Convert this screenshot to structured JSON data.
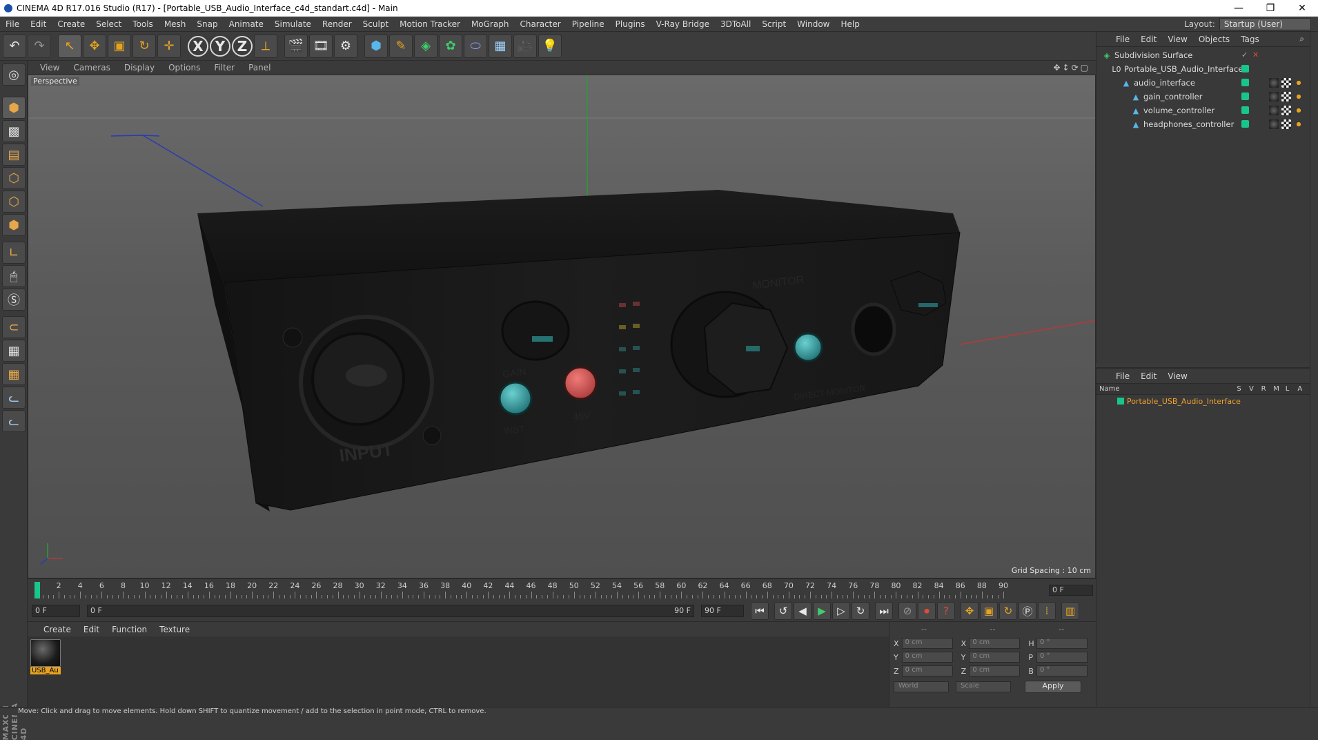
{
  "window": {
    "title": "CINEMA 4D R17.016 Studio (R17) - [Portable_USB_Audio_Interface_c4d_standart.c4d] - Main",
    "controls": [
      "—",
      "❐",
      "✕"
    ]
  },
  "menubar": {
    "items": [
      "File",
      "Edit",
      "Create",
      "Select",
      "Tools",
      "Mesh",
      "Snap",
      "Animate",
      "Simulate",
      "Render",
      "Sculpt",
      "Motion Tracker",
      "MoGraph",
      "Character",
      "Pipeline",
      "Plugins",
      "V-Ray Bridge",
      "3DToAll",
      "Script",
      "Window",
      "Help"
    ],
    "layout_label": "Layout:",
    "layout_value": "Startup (User)"
  },
  "toolbar": {
    "undo": "↶",
    "redo": "↷",
    "select": "↖",
    "move": "✥",
    "scale": "▣",
    "rotate": "↻",
    "transform": "✛",
    "x_axis": "X",
    "y_axis": "Y",
    "z_axis": "Z",
    "coord": "⟂"
  },
  "viewport": {
    "menu": [
      "View",
      "Cameras",
      "Display",
      "Options",
      "Filter",
      "Panel"
    ],
    "nav_icons": "✥↕⟳▢",
    "label": "Perspective",
    "grid_spacing": "Grid Spacing : 10 cm",
    "model_labels": {
      "input": "INPUT",
      "gain": "GAIN",
      "monitor": "MONITOR",
      "direct_monitor": "DIRECT MONITOR",
      "instrument": "INST",
      "phantom": "48V"
    }
  },
  "timeline": {
    "ticks": [
      "0",
      "2",
      "4",
      "6",
      "8",
      "10",
      "12",
      "14",
      "16",
      "18",
      "20",
      "22",
      "24",
      "26",
      "28",
      "30",
      "32",
      "34",
      "36",
      "38",
      "40",
      "42",
      "44",
      "46",
      "48",
      "50",
      "52",
      "54",
      "56",
      "58",
      "60",
      "62",
      "64",
      "66",
      "68",
      "70",
      "72",
      "74",
      "76",
      "78",
      "80",
      "82",
      "84",
      "86",
      "88",
      "90"
    ],
    "current_frame": "0 F"
  },
  "transport": {
    "start_field": "0 F",
    "range_start": "0 F",
    "range_end": "90 F",
    "end_field": "90 F"
  },
  "material_manager": {
    "menu": [
      "Create",
      "Edit",
      "Function",
      "Texture"
    ],
    "materials": [
      {
        "name": "USB_Au"
      }
    ]
  },
  "coordinates": {
    "headers": [
      "--",
      "--",
      "--"
    ],
    "rows": [
      {
        "a1": "X",
        "v1": "0 cm",
        "a2": "X",
        "v2": "0 cm",
        "a3": "H",
        "v3": "0 °"
      },
      {
        "a1": "Y",
        "v1": "0 cm",
        "a2": "Y",
        "v2": "0 cm",
        "a3": "P",
        "v3": "0 °"
      },
      {
        "a1": "Z",
        "v1": "0 cm",
        "a2": "Z",
        "v2": "0 cm",
        "a3": "B",
        "v3": "0 °"
      }
    ],
    "mode": "World",
    "transform": "Scale",
    "apply": "Apply"
  },
  "object_manager": {
    "menu": [
      "File",
      "Edit",
      "View",
      "Objects",
      "Tags"
    ],
    "objects": [
      {
        "name": "Subdivision Surface",
        "depth": 0
      },
      {
        "name": "Portable_USB_Audio_Interface",
        "depth": 1
      },
      {
        "name": "audio_interface",
        "depth": 2
      },
      {
        "name": "gain_controller",
        "depth": 3
      },
      {
        "name": "volume_controller",
        "depth": 3
      },
      {
        "name": "headphones_controller",
        "depth": 3
      }
    ]
  },
  "layer_manager": {
    "menu": [
      "File",
      "Edit",
      "View"
    ],
    "columns": {
      "name": "Name",
      "flags": [
        "S",
        "V",
        "R",
        "M",
        "L",
        "A"
      ]
    },
    "rows": [
      {
        "name": "Portable_USB_Audio_Interface"
      }
    ]
  },
  "status": "Move: Click and drag to move elements. Hold down SHIFT to quantize movement / add to the selection in point mode, CTRL to remove.",
  "branding": "MAXON CINEMA 4D",
  "colors": {
    "accent": "#e6a321",
    "layer_green": "#19c68a",
    "timeline_marker": "#19c68a"
  }
}
